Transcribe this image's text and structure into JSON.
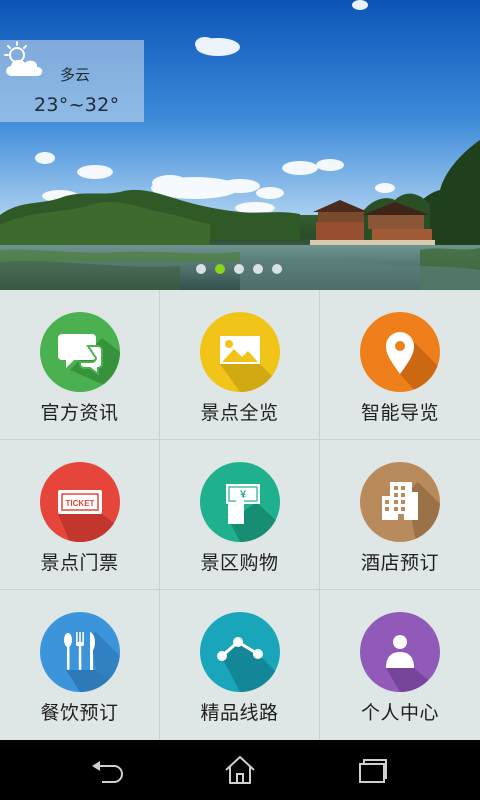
{
  "weather": {
    "condition": "多云",
    "temperature": "23°~32°",
    "icon": "partly-cloudy-icon"
  },
  "carousel": {
    "count": 5,
    "active_index": 1
  },
  "menu": [
    {
      "label": "官方资讯",
      "icon": "chat-bubbles-icon",
      "color": "#4bb04f"
    },
    {
      "label": "景点全览",
      "icon": "landscape-picture-icon",
      "color": "#f0c419"
    },
    {
      "label": "智能导览",
      "icon": "map-pin-icon",
      "color": "#ef7f1b"
    },
    {
      "label": "景点门票",
      "icon": "ticket-icon",
      "color": "#e5453a"
    },
    {
      "label": "景区购物",
      "icon": "shopping-cash-icon",
      "color": "#1fb08e"
    },
    {
      "label": "酒店预订",
      "icon": "hotel-building-icon",
      "color": "#b98a5b"
    },
    {
      "label": "餐饮预订",
      "icon": "cutlery-icon",
      "color": "#3c95db"
    },
    {
      "label": "精品线路",
      "icon": "route-icon",
      "color": "#19a6bb"
    },
    {
      "label": "个人中心",
      "icon": "person-icon",
      "color": "#9159b8"
    }
  ],
  "navbar": {
    "back_icon": "back-icon",
    "home_icon": "home-icon",
    "recent_icon": "recent-apps-icon"
  }
}
